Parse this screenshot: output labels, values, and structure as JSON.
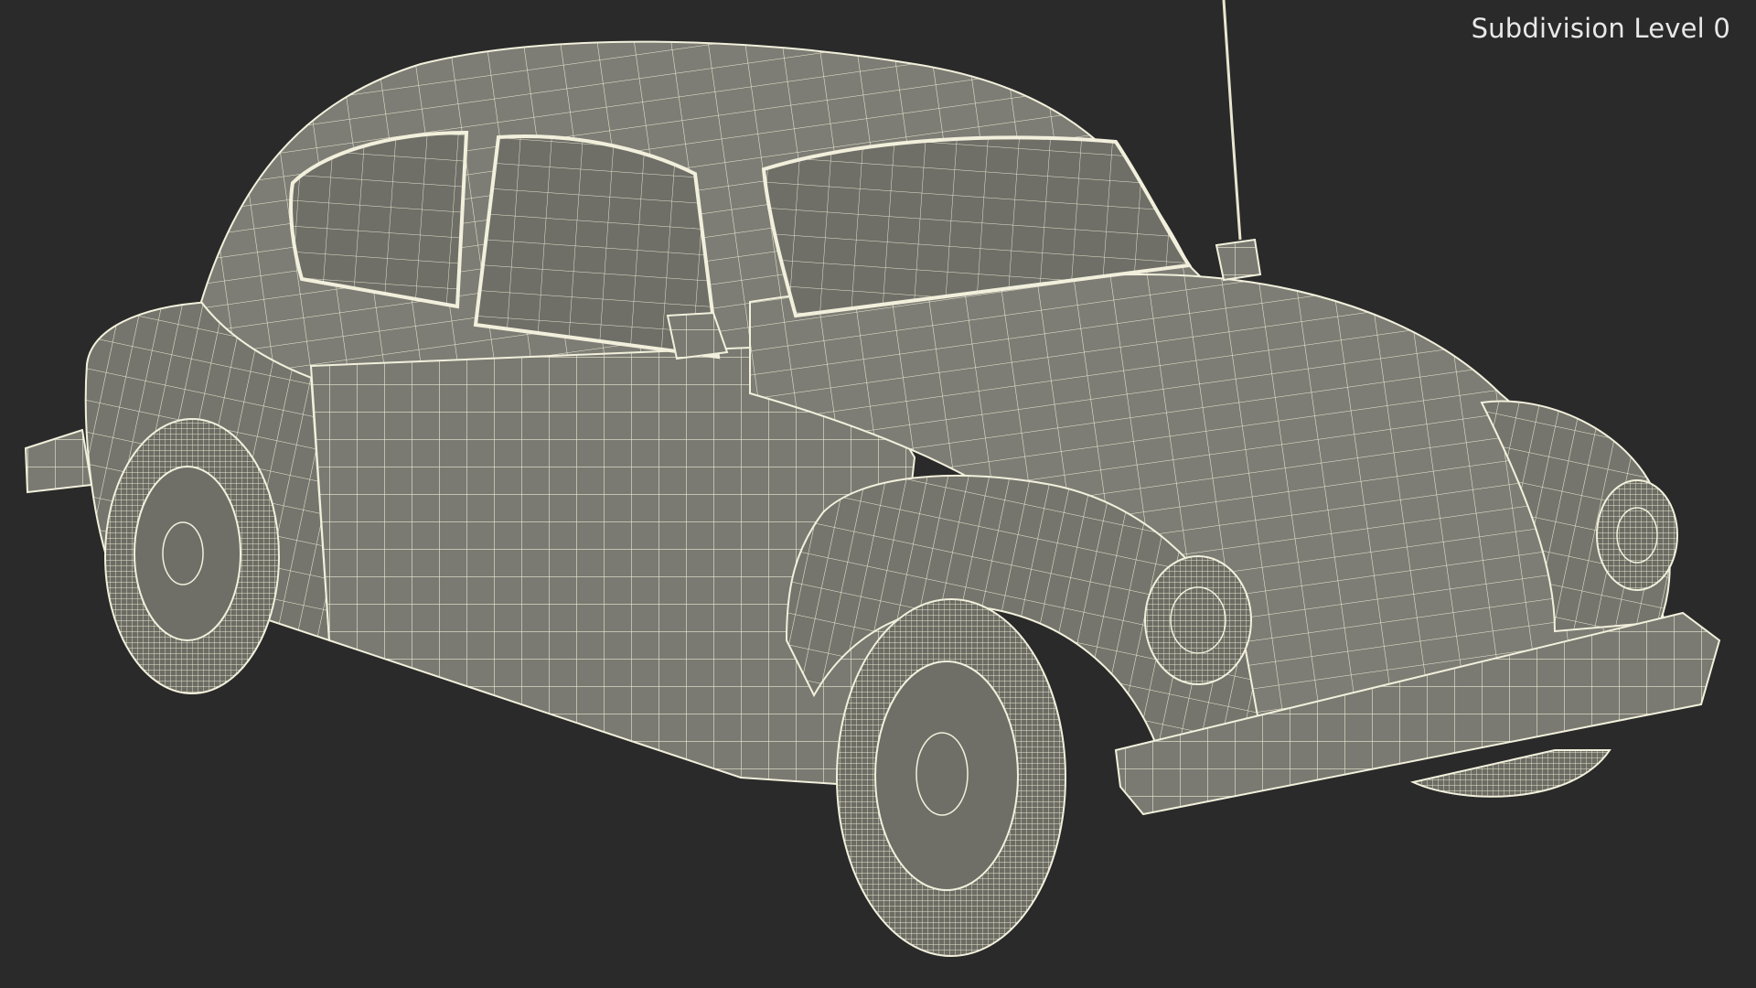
{
  "viewport": {
    "label": "Subdivision Level 0",
    "background_color": "#2a2a2a",
    "mesh_fill_color": "#7a7a72",
    "wire_color": "#f2f0dc"
  },
  "scene": {
    "subject": "car-wireframe-model"
  }
}
